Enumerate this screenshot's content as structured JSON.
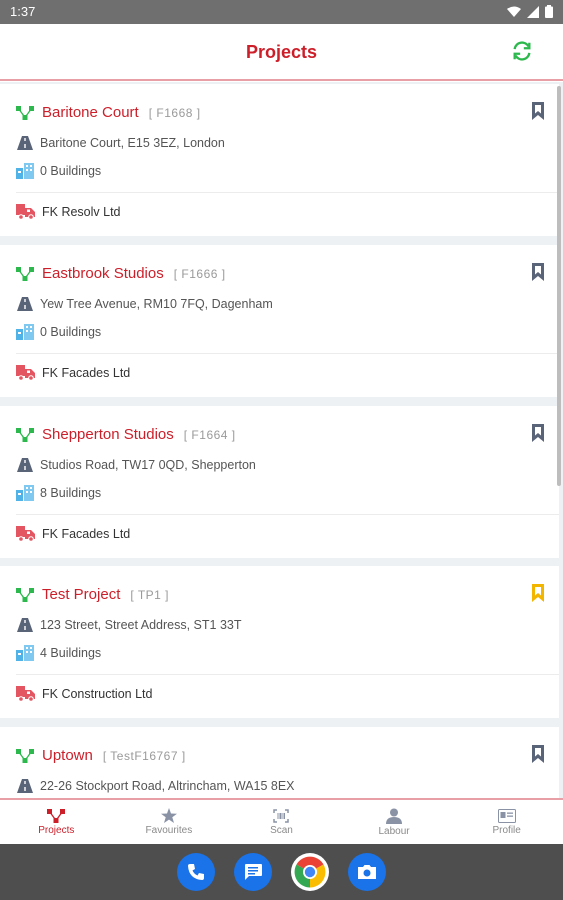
{
  "status": {
    "time": "1:37"
  },
  "appbar": {
    "title": "Projects"
  },
  "projects": [
    {
      "name": "Baritone Court",
      "code": "[ F1668 ]",
      "address": "Baritone Court, E15 3EZ, London",
      "buildings": "0 Buildings",
      "company": "FK Resolv Ltd",
      "favourite": false
    },
    {
      "name": "Eastbrook Studios",
      "code": "[ F1666 ]",
      "address": "Yew Tree Avenue, RM10 7FQ, Dagenham",
      "buildings": "0 Buildings",
      "company": "FK Facades Ltd",
      "favourite": false
    },
    {
      "name": "Shepperton Studios",
      "code": "[ F1664 ]",
      "address": "Studios Road, TW17 0QD, Shepperton",
      "buildings": "8 Buildings",
      "company": "FK Facades Ltd",
      "favourite": false
    },
    {
      "name": "Test Project",
      "code": "[ TP1 ]",
      "address": "123 Street, Street Address, ST1 33T",
      "buildings": "4 Buildings",
      "company": "FK Construction Ltd",
      "favourite": true
    },
    {
      "name": "Uptown",
      "code": "[ TestF16767 ]",
      "address": "22-26 Stockport Road, Altrincham, WA15 8EX",
      "buildings": "",
      "company": "",
      "favourite": false
    }
  ],
  "nav": [
    {
      "label": "Projects",
      "icon": "projects-icon",
      "active": true
    },
    {
      "label": "Favourites",
      "icon": "star-icon",
      "active": false
    },
    {
      "label": "Scan",
      "icon": "scan-icon",
      "active": false
    },
    {
      "label": "Labour",
      "icon": "person-icon",
      "active": false
    },
    {
      "label": "Profile",
      "icon": "id-card-icon",
      "active": false
    }
  ],
  "colors": {
    "brand": "#cc1f2a",
    "favourite": "#f2b600",
    "bookmark": "#5a6478",
    "accent_green": "#2db84d",
    "building_blue": "#4fb3e8"
  }
}
